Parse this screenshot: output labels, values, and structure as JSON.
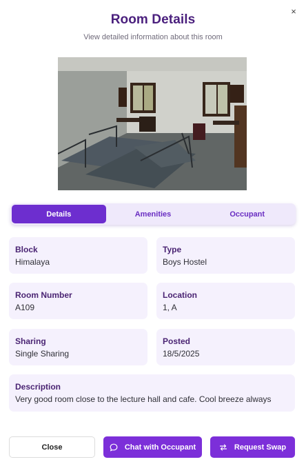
{
  "dialog": {
    "title": "Room Details",
    "subtitle": "View detailed information about this room",
    "close_glyph": "×"
  },
  "tabs": [
    {
      "label": "Details",
      "active": true
    },
    {
      "label": "Amenities",
      "active": false
    },
    {
      "label": "Occupant",
      "active": false
    }
  ],
  "details": {
    "block": {
      "label": "Block",
      "value": "Himalaya"
    },
    "type": {
      "label": "Type",
      "value": "Boys Hostel"
    },
    "room_number": {
      "label": "Room Number",
      "value": "A109"
    },
    "location": {
      "label": "Location",
      "value": "1, A"
    },
    "sharing": {
      "label": "Sharing",
      "value": "Single Sharing"
    },
    "posted": {
      "label": "Posted",
      "value": "18/5/2025"
    },
    "description": {
      "label": "Description",
      "value": "Very good room close to the lecture hall and cafe. Cool breeze always"
    }
  },
  "actions": {
    "close_label": "Close",
    "chat_label": "Chat with Occupant",
    "swap_label": "Request Swap"
  },
  "colors": {
    "accent": "#7c2fd9",
    "title": "#4a1f7d",
    "card_bg": "#f5f1fd"
  },
  "icons": {
    "dialog_close": "close-icon",
    "chat": "chat-bubble-icon",
    "swap": "swap-arrows-icon"
  }
}
